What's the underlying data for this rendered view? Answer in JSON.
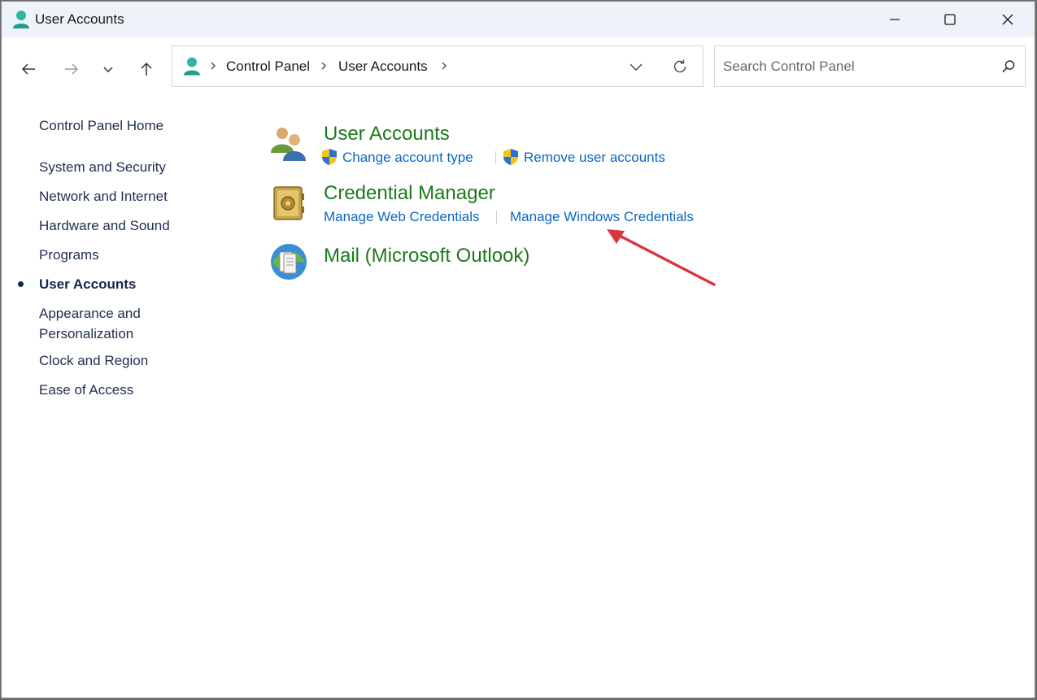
{
  "window": {
    "title": "User Accounts"
  },
  "address": {
    "breadcrumbs": [
      "Control Panel",
      "User Accounts"
    ]
  },
  "search": {
    "placeholder": "Search Control Panel"
  },
  "sidebar": {
    "home": "Control Panel Home",
    "items": [
      {
        "label": "System and Security"
      },
      {
        "label": "Network and Internet"
      },
      {
        "label": "Hardware and Sound"
      },
      {
        "label": "Programs"
      },
      {
        "label": "User Accounts",
        "active": true
      },
      {
        "label": "Appearance and"
      },
      {
        "label": "Personalization"
      },
      {
        "label": "Clock and Region"
      },
      {
        "label": "Ease of Access"
      }
    ]
  },
  "main": {
    "sections": [
      {
        "title": "User Accounts",
        "links": [
          "Change account type",
          "Remove user accounts"
        ]
      },
      {
        "title": "Credential Manager",
        "links": [
          "Manage Web Credentials",
          "Manage Windows Credentials"
        ]
      },
      {
        "title": "Mail (Microsoft Outlook)",
        "links": []
      }
    ]
  },
  "colors": {
    "link": "#0b66c3",
    "section_title": "#1a7a1a",
    "sidebar_text": "#1f2d4d",
    "annotation_arrow": "#d9363e"
  },
  "icons": [
    "user-accounts-icon",
    "back-arrow-icon",
    "forward-arrow-icon",
    "recent-dropdown-icon",
    "up-arrow-icon",
    "refresh-icon",
    "search-icon",
    "minimize-icon",
    "maximize-icon",
    "close-icon",
    "uac-shield-icon",
    "credential-safe-icon",
    "mail-icon"
  ]
}
